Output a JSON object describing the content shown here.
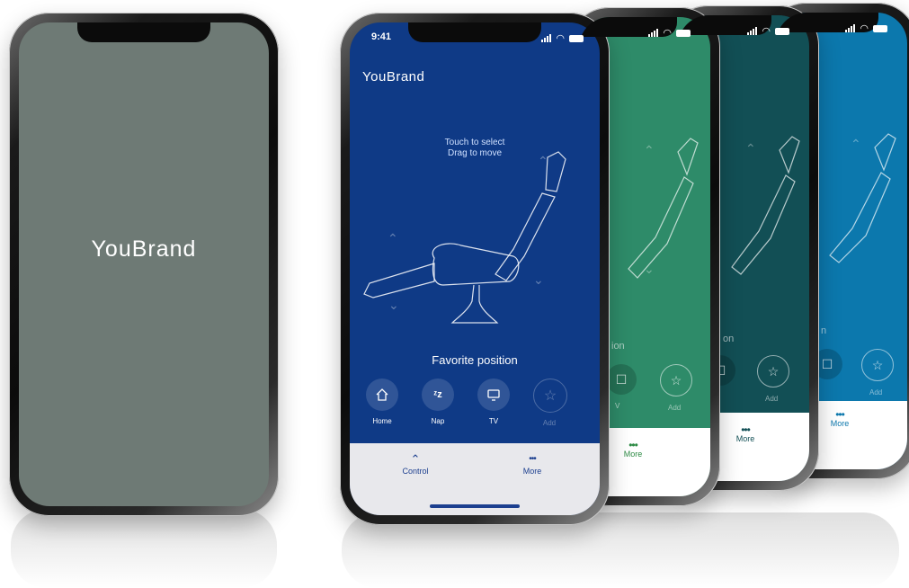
{
  "splash": {
    "logo_text": "YouBrand",
    "background_color": "#6e7a75"
  },
  "main": {
    "status_time": "9:41",
    "brand": "YouBrand",
    "hint_line1": "Touch to select",
    "hint_line2": "Drag to move",
    "favorite_title": "Favorite position",
    "favorites": [
      {
        "label": "Home",
        "icon": "home-icon"
      },
      {
        "label": "Nap",
        "icon": "zzz-icon"
      },
      {
        "label": "TV",
        "icon": "tv-icon"
      },
      {
        "label": "Add",
        "icon": "star-icon"
      }
    ],
    "tabs": [
      {
        "label": "Control",
        "icon": "chevron-up-down-icon"
      },
      {
        "label": "More",
        "icon": "more-dots-icon"
      }
    ],
    "background_color": "#0f3a86",
    "tabbar_color": "#e8e8ec"
  },
  "green_screen": {
    "background_color": "#2e8b69",
    "partial_text": "ion",
    "partial_tv": "V",
    "add_label": "Add",
    "more_label": "More",
    "accent": "#2e8b45"
  },
  "teal_screen": {
    "background_color": "#124f55",
    "partial_text": "on",
    "add_label": "Add",
    "more_label": "More"
  },
  "blue_screen": {
    "background_color": "#0c78ad",
    "partial_text": "n",
    "add_label": "Add",
    "more_label": "More",
    "accent": "#0c78ad"
  }
}
